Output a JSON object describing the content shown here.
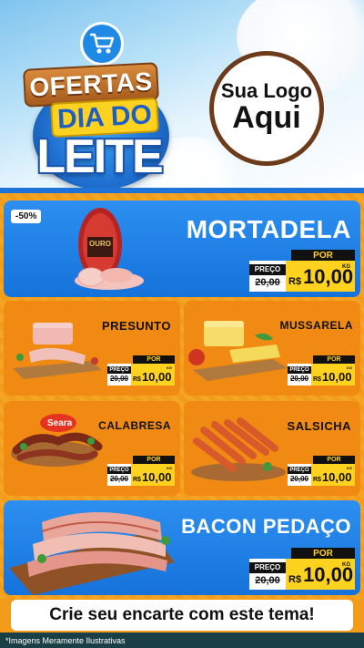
{
  "header": {
    "title_line1": "OFERTAS",
    "title_line2": "DIA DO",
    "title_line3": "LEITE",
    "logo_line1": "Sua Logo",
    "logo_line2": "Aqui",
    "icon": "shopping-cart-icon"
  },
  "products": [
    {
      "name": "MORTADELA",
      "discount": "-50%",
      "brand": "OURO",
      "price_label": "PREÇO",
      "old_price": "20,00",
      "por": "POR",
      "currency": "R$",
      "new_price": "10,00",
      "unit": "KG"
    },
    {
      "name": "PRESUNTO",
      "price_label": "PREÇO",
      "old_price": "20,00",
      "por": "POR",
      "currency": "R$",
      "new_price": "10,00",
      "unit": "KG"
    },
    {
      "name": "MUSSARELA",
      "price_label": "PREÇO",
      "old_price": "20,00",
      "por": "POR",
      "currency": "R$",
      "new_price": "10,00",
      "unit": "KG"
    },
    {
      "name": "CALABRESA",
      "brand": "Seara",
      "price_label": "PREÇO",
      "old_price": "20,00",
      "por": "POR",
      "currency": "R$",
      "new_price": "10,00",
      "unit": "KG"
    },
    {
      "name": "SALSICHA",
      "price_label": "PREÇO",
      "old_price": "20,00",
      "por": "POR",
      "currency": "R$",
      "new_price": "10,00",
      "unit": "KG"
    },
    {
      "name": "BACON PEDAÇO",
      "price_label": "PREÇO",
      "old_price": "20,00",
      "por": "POR",
      "currency": "R$",
      "new_price": "10,00",
      "unit": "KG"
    }
  ],
  "footer": {
    "cta": "Crie seu encarte com este tema!",
    "note": "*Imagens Meramente Ilustrativas"
  },
  "colors": {
    "blue": "#1e74d6",
    "orange": "#f39c1c",
    "yellow": "#ffd21f",
    "brown": "#6d3a1a"
  }
}
